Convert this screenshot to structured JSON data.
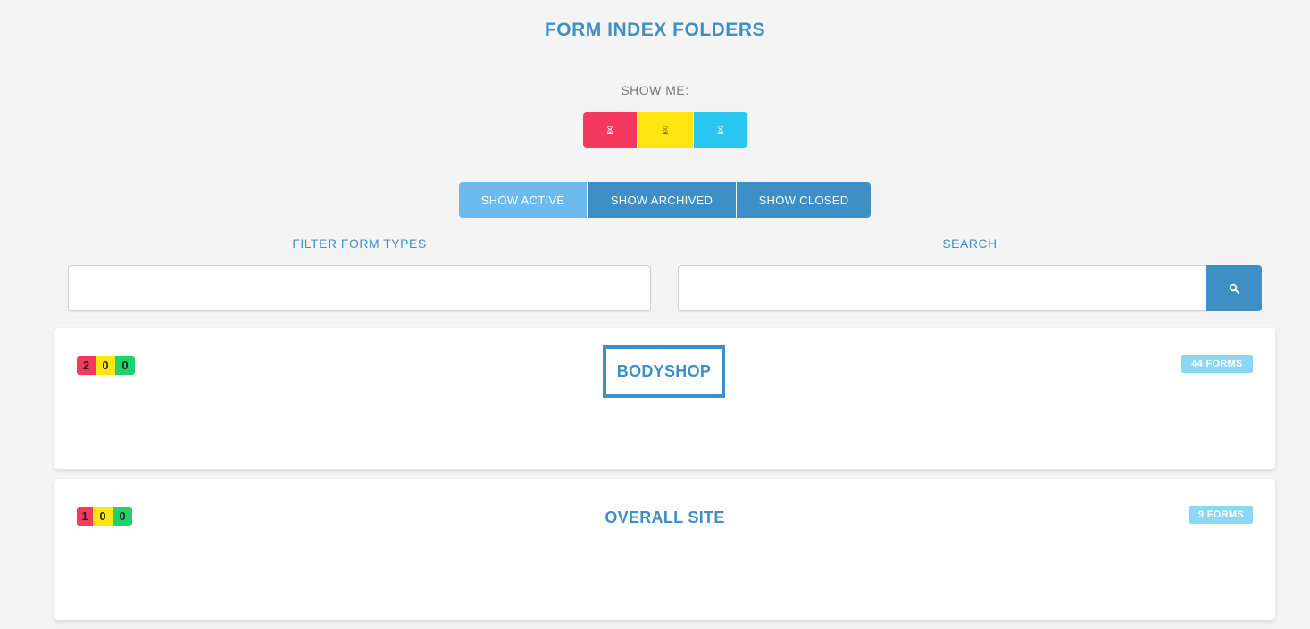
{
  "header": {
    "title": "FORM INDEX FOLDERS"
  },
  "status_filter": {
    "label": "SHOW ME:",
    "buttons": [
      {
        "icon": "hourglass-icon",
        "color": "#f5385e"
      },
      {
        "icon": "hourglass-icon",
        "color": "#fde512"
      },
      {
        "icon": "hourglass-icon",
        "color": "#2ac6f2"
      }
    ]
  },
  "view_filter": {
    "show_active": "SHOW ACTIVE",
    "show_archived": "SHOW ARCHIVED",
    "show_closed": "SHOW CLOSED"
  },
  "filters": {
    "filter_label": "FILTER FORM TYPES",
    "filter_value": "",
    "search_label": "SEARCH",
    "search_value": "",
    "search_icon": "search-icon"
  },
  "folders": [
    {
      "name": "BODYSHOP",
      "red": "2",
      "yellow": "0",
      "green": "0",
      "forms": "44 FORMS"
    },
    {
      "name": "OVERALL SITE",
      "red": "1",
      "yellow": "0",
      "green": "0",
      "forms": "9 FORMS"
    }
  ],
  "colors": {
    "accent": "#3d8fc6",
    "active": "#6cbaee",
    "red": "#f5385e",
    "yellow": "#fde512",
    "green": "#1ed36b",
    "cyan": "#2ac6f2",
    "badge": "#8ad8f5"
  }
}
